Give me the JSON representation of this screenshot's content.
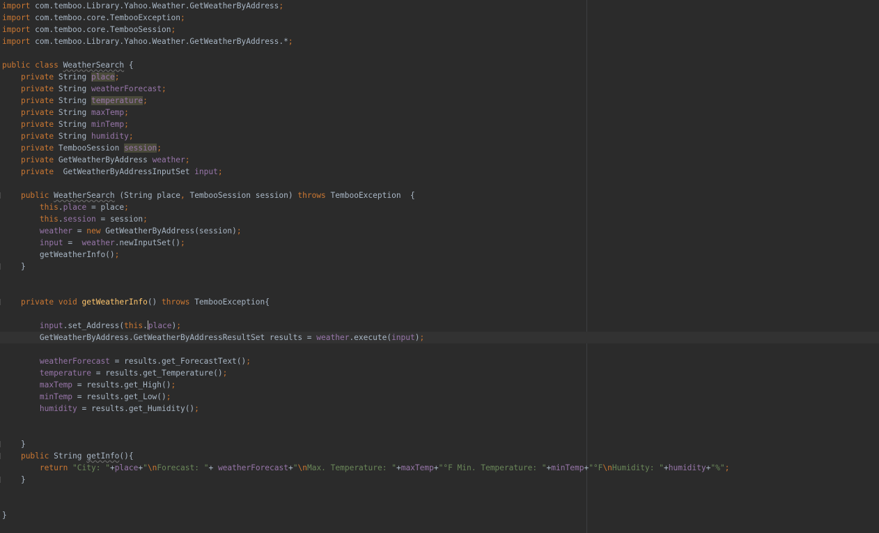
{
  "editor": {
    "colors": {
      "background": "#2b2b2b",
      "keyword": "#cc7832",
      "field": "#9876aa",
      "string": "#6a8759",
      "method": "#ffc66d",
      "text": "#a9b7c6"
    },
    "caret_line": 28,
    "lines": [
      [
        [
          "kw",
          "import "
        ],
        [
          "plain",
          "com.temboo.Library.Yahoo.Weather.GetWeatherByAddress"
        ],
        [
          "kw",
          ";"
        ]
      ],
      [
        [
          "kw",
          "import "
        ],
        [
          "plain",
          "com.temboo.core.TembooException"
        ],
        [
          "kw",
          ";"
        ]
      ],
      [
        [
          "kw",
          "import "
        ],
        [
          "plain",
          "com.temboo.core.TembooSession"
        ],
        [
          "kw",
          ";"
        ]
      ],
      [
        [
          "kw",
          "import "
        ],
        [
          "plain",
          "com.temboo.Library.Yahoo.Weather.GetWeatherByAddress.*"
        ],
        [
          "kw",
          ";"
        ]
      ],
      [],
      [
        [
          "kw",
          "public class "
        ],
        [
          "unused",
          "WeatherSearch"
        ],
        [
          "plain",
          " {"
        ]
      ],
      [
        [
          "plain",
          "    "
        ],
        [
          "kw",
          "private "
        ],
        [
          "plain",
          "String "
        ],
        [
          "fld hl",
          "place"
        ],
        [
          "kw",
          ";"
        ]
      ],
      [
        [
          "plain",
          "    "
        ],
        [
          "kw",
          "private "
        ],
        [
          "plain",
          "String "
        ],
        [
          "fld",
          "weatherForecast"
        ],
        [
          "kw",
          ";"
        ]
      ],
      [
        [
          "plain",
          "    "
        ],
        [
          "kw",
          "private "
        ],
        [
          "plain",
          "String "
        ],
        [
          "fld hl",
          "temperature"
        ],
        [
          "kw",
          ";"
        ]
      ],
      [
        [
          "plain",
          "    "
        ],
        [
          "kw",
          "private "
        ],
        [
          "plain",
          "String "
        ],
        [
          "fld",
          "maxTemp"
        ],
        [
          "kw",
          ";"
        ]
      ],
      [
        [
          "plain",
          "    "
        ],
        [
          "kw",
          "private "
        ],
        [
          "plain",
          "String "
        ],
        [
          "fld",
          "minTemp"
        ],
        [
          "kw",
          ";"
        ]
      ],
      [
        [
          "plain",
          "    "
        ],
        [
          "kw",
          "private "
        ],
        [
          "plain",
          "String "
        ],
        [
          "fld",
          "humidity"
        ],
        [
          "kw",
          ";"
        ]
      ],
      [
        [
          "plain",
          "    "
        ],
        [
          "kw",
          "private "
        ],
        [
          "plain",
          "TembooSession "
        ],
        [
          "fld hl",
          "session"
        ],
        [
          "kw",
          ";"
        ]
      ],
      [
        [
          "plain",
          "    "
        ],
        [
          "kw",
          "private "
        ],
        [
          "plain",
          "GetWeatherByAddress "
        ],
        [
          "fld",
          "weather"
        ],
        [
          "kw",
          ";"
        ]
      ],
      [
        [
          "plain",
          "    "
        ],
        [
          "kw",
          "private  "
        ],
        [
          "plain",
          "GetWeatherByAddressInputSet "
        ],
        [
          "fld",
          "input"
        ],
        [
          "kw",
          ";"
        ]
      ],
      [],
      [
        [
          "plain",
          "    "
        ],
        [
          "kw",
          "public "
        ],
        [
          "unused",
          "WeatherSearch"
        ],
        [
          "plain",
          " (String place"
        ],
        [
          "kw",
          ", "
        ],
        [
          "plain",
          "TembooSession session) "
        ],
        [
          "kw",
          "throws "
        ],
        [
          "plain",
          "TembooException  {"
        ]
      ],
      [
        [
          "plain",
          "        "
        ],
        [
          "kw",
          "this"
        ],
        [
          "plain",
          "."
        ],
        [
          "fld",
          "place"
        ],
        [
          "plain",
          " = place"
        ],
        [
          "kw",
          ";"
        ]
      ],
      [
        [
          "plain",
          "        "
        ],
        [
          "kw",
          "this"
        ],
        [
          "plain",
          "."
        ],
        [
          "fld",
          "session"
        ],
        [
          "plain",
          " = session"
        ],
        [
          "kw",
          ";"
        ]
      ],
      [
        [
          "plain",
          "        "
        ],
        [
          "fld",
          "weather"
        ],
        [
          "plain",
          " = "
        ],
        [
          "kw",
          "new "
        ],
        [
          "plain",
          "GetWeatherByAddress(session)"
        ],
        [
          "kw",
          ";"
        ]
      ],
      [
        [
          "plain",
          "        "
        ],
        [
          "fld",
          "input"
        ],
        [
          "plain",
          " =  "
        ],
        [
          "fld",
          "weather"
        ],
        [
          "plain",
          ".newInputSet()"
        ],
        [
          "kw",
          ";"
        ]
      ],
      [
        [
          "plain",
          "        getWeatherInfo()"
        ],
        [
          "kw",
          ";"
        ]
      ],
      [
        [
          "plain",
          "    }"
        ]
      ],
      [],
      [],
      [
        [
          "plain",
          "    "
        ],
        [
          "kw",
          "private void "
        ],
        [
          "fn",
          "getWeatherInfo"
        ],
        [
          "plain",
          "() "
        ],
        [
          "kw",
          "throws "
        ],
        [
          "plain",
          "TembooException{"
        ]
      ],
      [],
      [
        [
          "plain",
          "        "
        ],
        [
          "fld",
          "input"
        ],
        [
          "plain",
          ".set_Address("
        ],
        [
          "kw",
          "this"
        ],
        [
          "plain",
          "."
        ],
        [
          "caret",
          ""
        ],
        [
          "fld",
          "place"
        ],
        [
          "plain",
          ")"
        ],
        [
          "kw",
          ";"
        ]
      ],
      [
        [
          "plain",
          "        GetWeatherByAddress.GetWeatherByAddressResultSet results = "
        ],
        [
          "fld",
          "weather"
        ],
        [
          "plain",
          ".execute("
        ],
        [
          "fld",
          "input"
        ],
        [
          "plain",
          ")"
        ],
        [
          "kw",
          ";"
        ]
      ],
      [],
      [
        [
          "plain",
          "        "
        ],
        [
          "fld",
          "weatherForecast"
        ],
        [
          "plain",
          " = results.get_ForecastText()"
        ],
        [
          "kw",
          ";"
        ]
      ],
      [
        [
          "plain",
          "        "
        ],
        [
          "fld",
          "temperature"
        ],
        [
          "plain",
          " = results.get_Temperature()"
        ],
        [
          "kw",
          ";"
        ]
      ],
      [
        [
          "plain",
          "        "
        ],
        [
          "fld",
          "maxTemp"
        ],
        [
          "plain",
          " = results.get_High()"
        ],
        [
          "kw",
          ";"
        ]
      ],
      [
        [
          "plain",
          "        "
        ],
        [
          "fld",
          "minTemp"
        ],
        [
          "plain",
          " = results.get_Low()"
        ],
        [
          "kw",
          ";"
        ]
      ],
      [
        [
          "plain",
          "        "
        ],
        [
          "fld",
          "humidity"
        ],
        [
          "plain",
          " = results.get_Humidity()"
        ],
        [
          "kw",
          ";"
        ]
      ],
      [],
      [],
      [
        [
          "plain",
          "    }"
        ]
      ],
      [
        [
          "plain",
          "    "
        ],
        [
          "kw",
          "public "
        ],
        [
          "plain",
          "String "
        ],
        [
          "unused",
          "getInfo"
        ],
        [
          "plain",
          "(){"
        ]
      ],
      [
        [
          "plain",
          "        "
        ],
        [
          "kw",
          "return "
        ],
        [
          "str",
          "\"City: \""
        ],
        [
          "plain",
          "+"
        ],
        [
          "fld",
          "place"
        ],
        [
          "plain",
          "+"
        ],
        [
          "str",
          "\""
        ],
        [
          "esc",
          "\\n"
        ],
        [
          "str",
          "Forecast: \""
        ],
        [
          "plain",
          "+ "
        ],
        [
          "fld",
          "weatherForecast"
        ],
        [
          "plain",
          "+"
        ],
        [
          "str",
          "\""
        ],
        [
          "esc",
          "\\n"
        ],
        [
          "str",
          "Max. Temperature: \""
        ],
        [
          "plain",
          "+"
        ],
        [
          "fld",
          "maxTemp"
        ],
        [
          "plain",
          "+"
        ],
        [
          "str",
          "\"°F Min. Temperature: \""
        ],
        [
          "plain",
          "+"
        ],
        [
          "fld",
          "minTemp"
        ],
        [
          "plain",
          "+"
        ],
        [
          "str",
          "\"°F"
        ],
        [
          "esc",
          "\\n"
        ],
        [
          "str",
          "Humidity: \""
        ],
        [
          "plain",
          "+"
        ],
        [
          "fld",
          "humidity"
        ],
        [
          "plain",
          "+"
        ],
        [
          "str",
          "\"%\""
        ],
        [
          "kw",
          ";"
        ]
      ],
      [
        [
          "plain",
          "    }"
        ]
      ],
      [],
      [],
      [
        [
          "plain",
          "}"
        ]
      ]
    ]
  }
}
